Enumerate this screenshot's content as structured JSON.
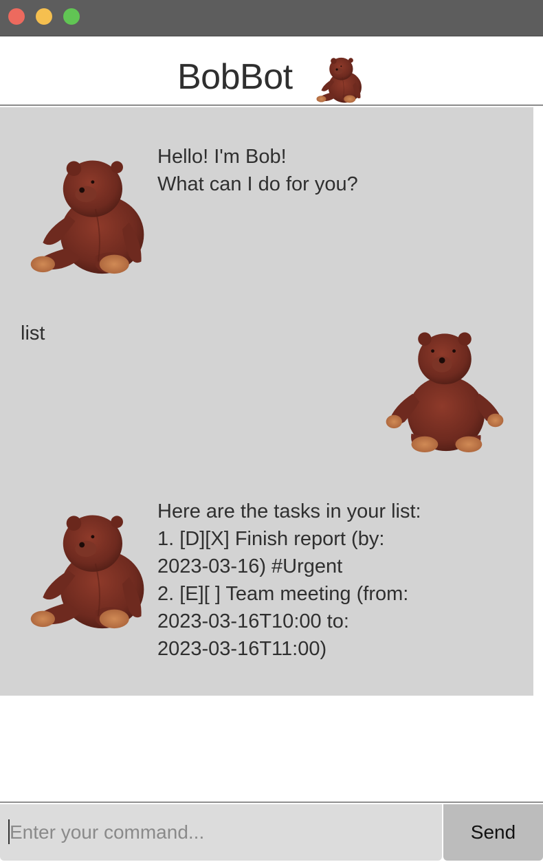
{
  "window": {
    "controls": [
      "close",
      "minimize",
      "zoom"
    ]
  },
  "header": {
    "title": "BobBot",
    "icon": "bear-avatar-icon"
  },
  "chat": {
    "messages": [
      {
        "sender": "bot",
        "avatar": "bear-avatar-icon",
        "text": "Hello! I'm Bob!\nWhat can I do for you?"
      },
      {
        "sender": "user",
        "avatar": "bear-avatar-icon",
        "text": "list"
      },
      {
        "sender": "bot",
        "avatar": "bear-avatar-icon",
        "text": "Here are the tasks in your list:\n1. [D][X] Finish report (by:\n2023-03-16) #Urgent\n2. [E][ ] Team meeting (from:\n2023-03-16T10:00 to:\n2023-03-16T11:00)"
      }
    ]
  },
  "input": {
    "placeholder": "Enter your command...",
    "value": ""
  },
  "send_button": {
    "label": "Send"
  },
  "colors": {
    "titlebar": "#5d5d5d",
    "chat_background": "#d3d3d3",
    "bear_fur": "#7a2f22",
    "bear_paw": "#c27a48"
  }
}
